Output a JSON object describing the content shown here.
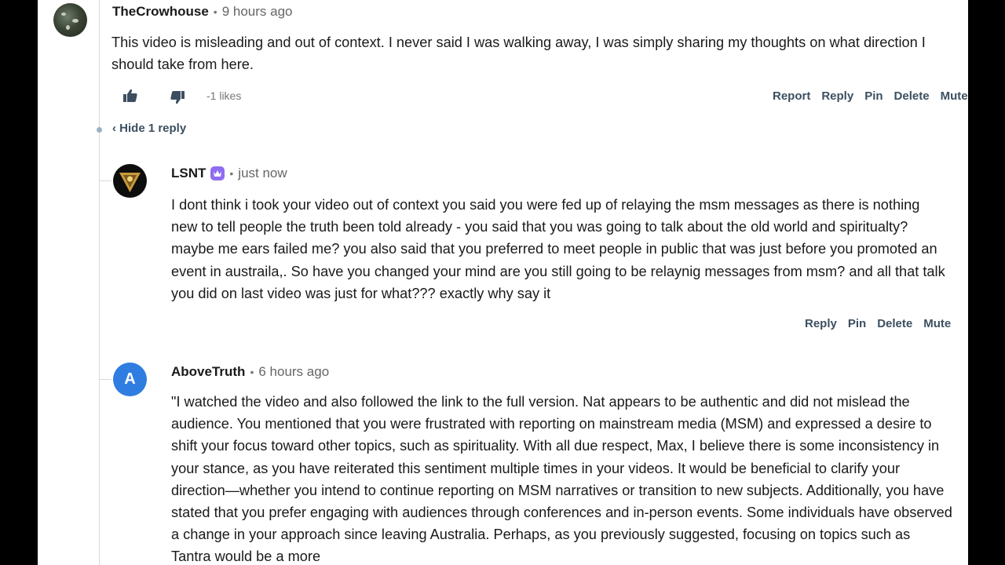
{
  "comments": [
    {
      "username": "TheCrowhouse",
      "time": "9 hours ago",
      "text": "This video is misleading and out of context. I never said I was walking away, I was simply sharing my thoughts on what direction I should take from here.",
      "likes": "-1 likes",
      "actions": [
        "Report",
        "Reply",
        "Pin",
        "Delete",
        "Mute"
      ],
      "toggle_replies": "‹ Hide 1 reply"
    },
    {
      "username": "LSNT",
      "time": "just now",
      "text": "I dont think i took your video out of context you said you were fed up of relaying the msm messages as there is nothing new to tell people the truth been told already - you said that you was going to talk about the old world and spiritualty? maybe me ears failed me? you also said that you preferred to meet people in public that was just before you promoted an event in austraila,. So have you changed your mind are you still going to be relaynig messages from msm? and all that talk you did on last video was just for what??? exactly why say it",
      "actions": [
        "Reply",
        "Pin",
        "Delete",
        "Mute"
      ]
    },
    {
      "username": "AboveTruth",
      "avatar_letter": "A",
      "time": "6 hours ago",
      "text": "\"I watched the video and also followed the link to the full version. Nat appears to be authentic and did not mislead the audience. You mentioned that you were frustrated with reporting on mainstream media (MSM) and expressed a desire to shift your focus toward other topics, such as spirituality. With all due respect, Max, I believe there is some inconsistency in your stance, as you have reiterated this sentiment multiple times in your videos. It would be beneficial to clarify your direction—whether you intend to continue reporting on MSM narratives or transition to new subjects. Additionally, you have stated that you prefer engaging with audiences through conferences and in-person events. Some individuals have observed a change in your approach since leaving Australia. Perhaps, as you previously suggested, focusing on topics such as Tantra would be a more"
    }
  ],
  "colors": {
    "action_text": "#3c4f60",
    "crown_badge": "#8f6df0",
    "avatar_blue": "#2f7de1"
  }
}
